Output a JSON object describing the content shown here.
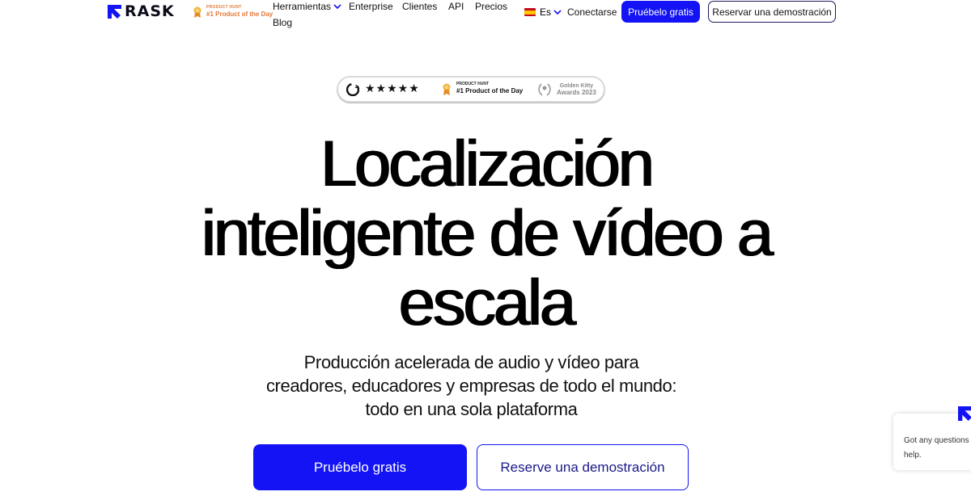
{
  "header": {
    "logo_text": "RASK",
    "product_hunt_badge": {
      "small": "PRODUCT HUNT",
      "main": "#1 Product of the Day"
    },
    "nav": {
      "herramientas": "Herramientas",
      "enterprise": "Enterprise",
      "clientes": "Clientes",
      "api": "API",
      "precios": "Precios",
      "blog": "Blog"
    },
    "language": "Es",
    "login": "Conectarse",
    "try_free": "Pruébelo gratis",
    "book_demo": "Reservar una demostración"
  },
  "awards": {
    "g2_rating_stars": "★★★★★",
    "product_hunt_small": "PRODUCT HUNT",
    "product_hunt_main": "#1 Product of the Day",
    "golden_kitty_line1": "Golden Kitty",
    "golden_kitty_line2": "Awards 2023"
  },
  "hero": {
    "title_line1": "Localización",
    "title_line2": "inteligente de vídeo a",
    "title_line3": "escala",
    "subtitle_line1": "Producción acelerada de audio y vídeo para",
    "subtitle_line2": "creadores, educadores y empresas de todo el mundo:",
    "subtitle_line3": "todo en una sola plataforma",
    "primary_cta": "Pruébelo gratis",
    "secondary_cta": "Reserve una demostración"
  },
  "chat_widget": {
    "line1": "Got any questions",
    "line2": "help."
  },
  "colors": {
    "accent": "#1313f5",
    "badge_orange": "#e07a3b"
  },
  "icons": [
    "rask-logo-icon",
    "medal-icon",
    "chevron-down-icon",
    "spain-flag-icon",
    "g2-icon",
    "laurel-icon"
  ]
}
